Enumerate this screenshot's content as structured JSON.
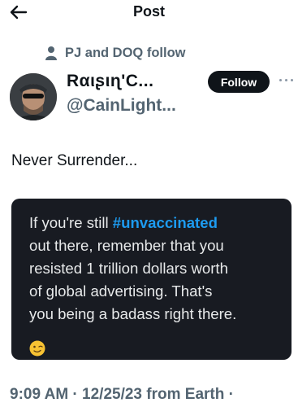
{
  "header": {
    "title": "Post"
  },
  "social_context": {
    "text": "PJ and DOQ follow"
  },
  "author": {
    "name": "Rαιʂιɳ'C...",
    "handle": "@CainLight..."
  },
  "follow_button": {
    "label": "Follow"
  },
  "post": {
    "text": "Never Surrender...",
    "card": {
      "lines": [
        "If you're still ",
        "#unvaccinated",
        "out there, remember that you",
        "resisted 1 trillion dollars worth",
        "of global advertising. That's",
        "you being a badass right there."
      ],
      "emoji": "winking-face"
    }
  },
  "meta": {
    "timestamp": "9:09 AM · 12/25/23 from Earth ·"
  },
  "colors": {
    "hashtag": "#1d9bf0",
    "card_bg": "#181b22",
    "button_bg": "#0f1419"
  }
}
